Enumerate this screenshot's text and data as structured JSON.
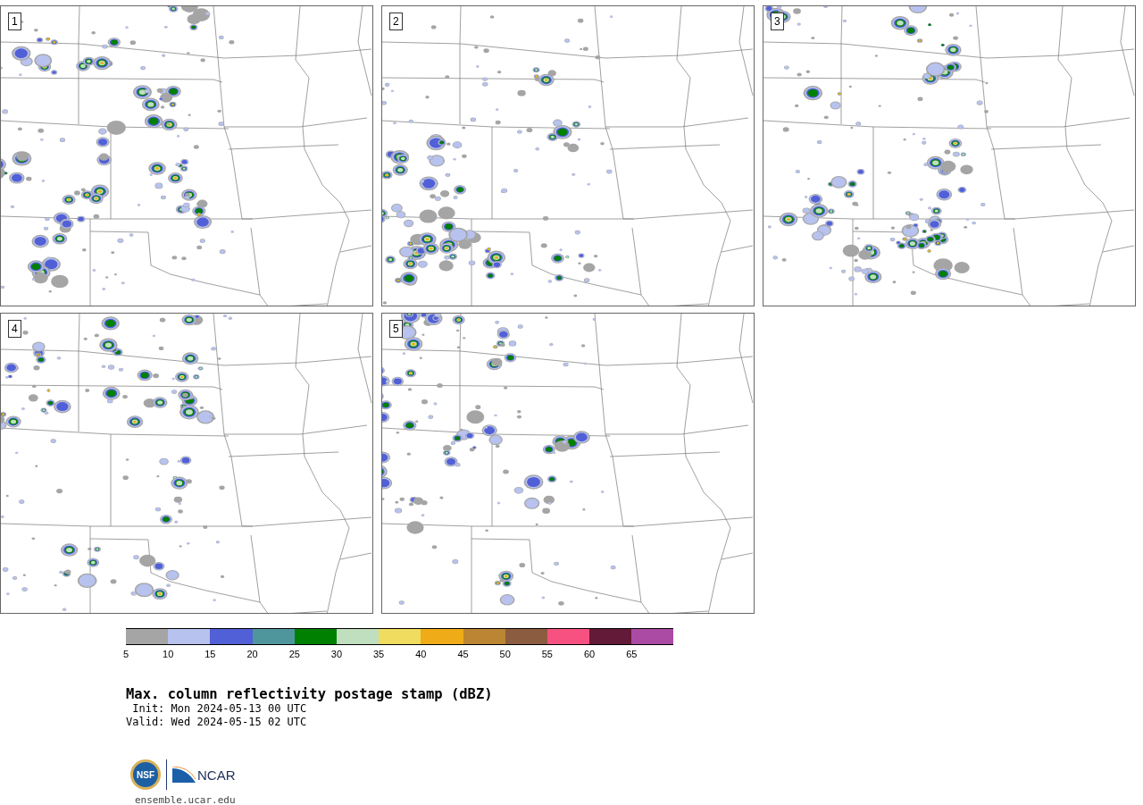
{
  "panels": [
    {
      "number": "1"
    },
    {
      "number": "2"
    },
    {
      "number": "3"
    },
    {
      "number": "4"
    },
    {
      "number": "5"
    }
  ],
  "colorbar": {
    "segments": [
      {
        "label": "5",
        "color": "#a5a5a5"
      },
      {
        "label": "10",
        "color": "#b7c2ee"
      },
      {
        "label": "15",
        "color": "#5160d6"
      },
      {
        "label": "20",
        "color": "#4f969c"
      },
      {
        "label": "25",
        "color": "#008000"
      },
      {
        "label": "30",
        "color": "#bfdfbf"
      },
      {
        "label": "35",
        "color": "#f0dc5f"
      },
      {
        "label": "40",
        "color": "#f0ac18"
      },
      {
        "label": "45",
        "color": "#bb8533"
      },
      {
        "label": "50",
        "color": "#8b5c3f"
      },
      {
        "label": "55",
        "color": "#f65181"
      },
      {
        "label": "60",
        "color": "#631938"
      },
      {
        "label": "65",
        "color": "#ab4ba3"
      }
    ]
  },
  "title": "Max. column reflectivity postage stamp (dBZ)",
  "init": " Init: Mon 2024-05-13 00 UTC",
  "valid": "Valid: Wed 2024-05-15 02 UTC",
  "logo": {
    "nsf": "NSF",
    "ncar": "NCAR"
  },
  "site": "ensemble.ucar.edu"
}
